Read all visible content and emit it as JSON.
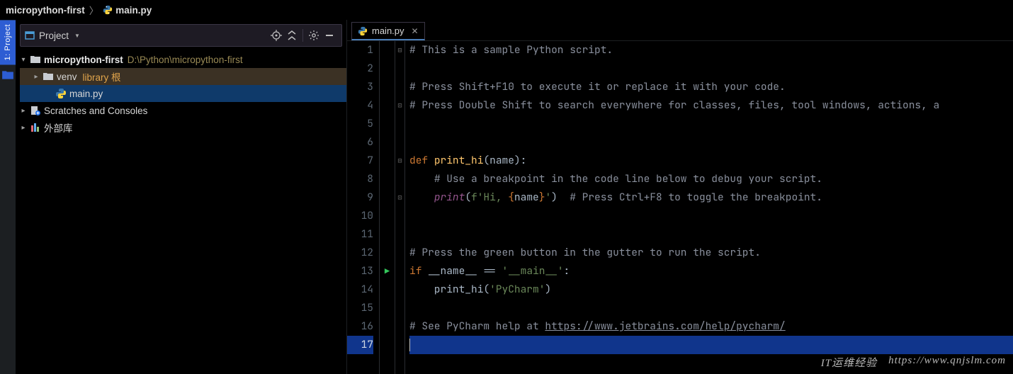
{
  "breadcrumb": {
    "items": [
      {
        "label": "micropython-first",
        "icon": null
      },
      {
        "label": "main.py",
        "icon": "python"
      }
    ],
    "separator": "〉"
  },
  "left_tab": {
    "label": "1: Project"
  },
  "project_panel": {
    "title": "Project",
    "root": {
      "label": "micropython-first",
      "path": "D:\\Python\\micropython-first"
    },
    "venv": {
      "label": "venv",
      "tag": "library 根"
    },
    "mainpy": {
      "label": "main.py"
    },
    "scratches": {
      "label": "Scratches and Consoles"
    },
    "external": {
      "label": "外部库"
    }
  },
  "editor": {
    "tab": {
      "label": "main.py"
    },
    "run_line": 13,
    "current_line": 17,
    "code": [
      {
        "n": 1,
        "fold": "open",
        "html": "<span class='tok-comment'># This is a sample Python script.</span>"
      },
      {
        "n": 2,
        "fold": "",
        "html": ""
      },
      {
        "n": 3,
        "fold": "",
        "html": "<span class='tok-comment'># Press Shift+F10 to execute it or replace it with your code.</span>"
      },
      {
        "n": 4,
        "fold": "close",
        "html": "<span class='tok-comment'># Press Double Shift to search everywhere for classes, files, tool windows, actions, a</span>"
      },
      {
        "n": 5,
        "fold": "",
        "html": ""
      },
      {
        "n": 6,
        "fold": "",
        "html": ""
      },
      {
        "n": 7,
        "fold": "open",
        "html": "<span class='tok-kw'>def</span> <span class='tok-fn'>print_hi</span>(name):"
      },
      {
        "n": 8,
        "fold": "",
        "html": "    <span class='tok-comment'># Use a breakpoint in the code line below to debug your script.</span>"
      },
      {
        "n": 9,
        "fold": "close",
        "html": "    <span class='tok-builtin'>print</span>(<span class='tok-str'>f'Hi, </span><span class='tok-brace'>{</span>name<span class='tok-brace'>}</span><span class='tok-str'>'</span>)  <span class='tok-comment'># Press Ctrl+F8 to toggle the breakpoint.</span>"
      },
      {
        "n": 10,
        "fold": "",
        "html": ""
      },
      {
        "n": 11,
        "fold": "",
        "html": ""
      },
      {
        "n": 12,
        "fold": "",
        "html": "<span class='tok-comment'># Press the green button in the gutter to run the script.</span>"
      },
      {
        "n": 13,
        "fold": "",
        "html": "<span class='tok-kw'>if</span> __name__ == <span class='tok-str'>'__main__'</span>:"
      },
      {
        "n": 14,
        "fold": "",
        "html": "    print_hi(<span class='tok-str'>'PyCharm'</span>)"
      },
      {
        "n": 15,
        "fold": "",
        "html": ""
      },
      {
        "n": 16,
        "fold": "",
        "html": "<span class='tok-comment'># See PyCharm help at </span><span class='tok-link'>https://www.jetbrains.com/help/pycharm/</span>"
      },
      {
        "n": 17,
        "fold": "",
        "html": ""
      }
    ]
  },
  "watermark": {
    "left": "IT运维经验",
    "right": "https://www.qnjslm.com"
  }
}
